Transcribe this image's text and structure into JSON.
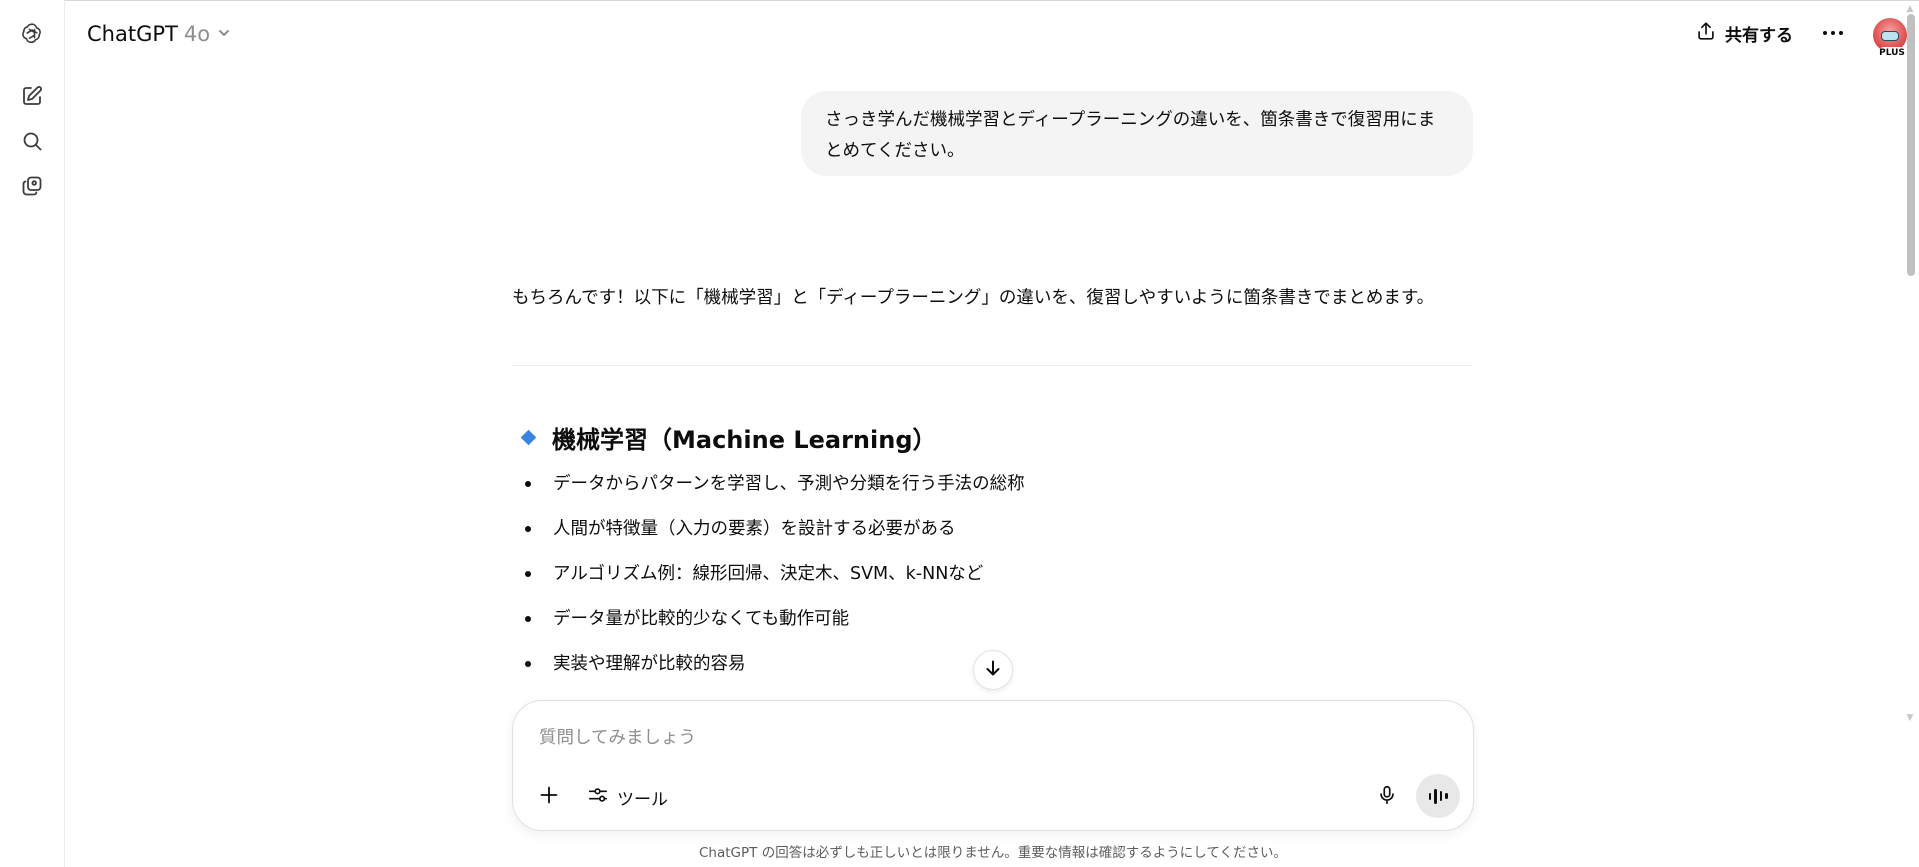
{
  "header": {
    "model_name": "ChatGPT",
    "model_version": "4o",
    "share_label": "共有する",
    "plan_badge": "PLUS"
  },
  "sidebar": {
    "items": [
      {
        "name": "new-chat",
        "icon": "compose-icon"
      },
      {
        "name": "search",
        "icon": "search-icon"
      },
      {
        "name": "library",
        "icon": "images-icon"
      }
    ]
  },
  "conversation": {
    "user_message": "さっき学んだ機械学習とディープラーニングの違いを、箇条書きで復習用にまとめてください。",
    "assistant_intro": "もちろんです！以下に「機械学習」と「ディープラーニング」の違いを、復習しやすいように箇条書きでまとめます。",
    "section_heading": "機械学習（Machine Learning）",
    "bullets": [
      "データからパターンを学習し、予測や分類を行う手法の総称",
      "人間が特徴量（入力の要素）を設計する必要がある",
      "アルゴリズム例：線形回帰、決定木、SVM、k-NNなど",
      "データ量が比較的少なくても動作可能",
      "実装や理解が比較的容易"
    ]
  },
  "composer": {
    "placeholder": "質問してみましょう",
    "tools_label": "ツール"
  },
  "footer": {
    "disclaimer": "ChatGPT の回答は必ずしも正しいとは限りません。重要な情報は確認するようにしてください。"
  },
  "colors": {
    "accent_diamond": "#3a84e0",
    "bubble_bg": "#f4f4f4",
    "voice_button_bg": "#e8e8e8"
  }
}
